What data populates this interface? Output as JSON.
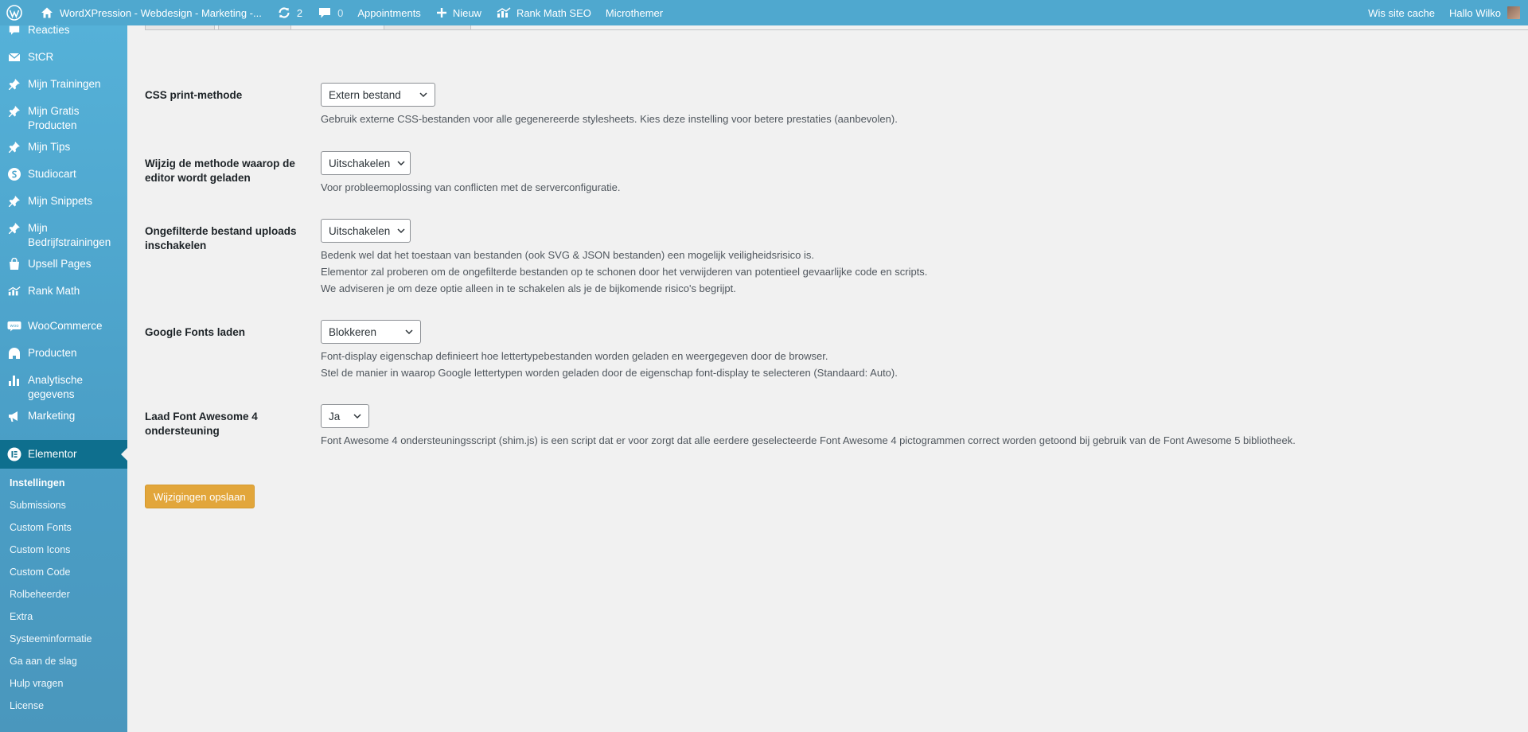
{
  "adminbar": {
    "site_title": "WordXPression - Webdesign - Marketing -...",
    "updates_count": "2",
    "comments_count": "0",
    "appointments": "Appointments",
    "new": "Nieuw",
    "rank_math": "Rank Math SEO",
    "microthemer": "Microthemer",
    "clear_cache": "Wis site cache",
    "greeting": "Hallo Wilko"
  },
  "sidebar": {
    "items": [
      {
        "label": "Reacties",
        "icon": "comment-icon"
      },
      {
        "label": "StCR",
        "icon": "mail-icon"
      },
      {
        "label": "Mijn Trainingen",
        "icon": "pin-icon"
      },
      {
        "label": "Mijn Gratis Producten",
        "icon": "pin-icon"
      },
      {
        "label": "Mijn Tips",
        "icon": "pin-icon"
      },
      {
        "label": "Studiocart",
        "icon": "studiocart-icon"
      },
      {
        "label": "Mijn Snippets",
        "icon": "pin-icon"
      },
      {
        "label": "Mijn Bedrijfstrainingen",
        "icon": "pin-icon"
      },
      {
        "label": "Upsell Pages",
        "icon": "bag-icon"
      },
      {
        "label": "Rank Math",
        "icon": "rank-math-icon"
      },
      {
        "label": "WooCommerce",
        "icon": "woocommerce-icon"
      },
      {
        "label": "Producten",
        "icon": "archive-icon"
      },
      {
        "label": "Analytische gegevens",
        "icon": "bar-chart-icon"
      },
      {
        "label": "Marketing",
        "icon": "megaphone-icon"
      },
      {
        "label": "Elementor",
        "icon": "elementor-icon"
      }
    ],
    "submenu": [
      "Instellingen",
      "Submissions",
      "Custom Fonts",
      "Custom Icons",
      "Custom Code",
      "Rolbeheerder",
      "Extra",
      "Systeeminformatie",
      "Ga aan de slag",
      "Hulp vragen",
      "License"
    ]
  },
  "settings": {
    "css_print": {
      "label": "CSS print-methode",
      "value": "Extern bestand",
      "desc": [
        "Gebruik externe CSS-bestanden voor alle gegenereerde stylesheets. Kies deze instelling voor betere prestaties (aanbevolen)."
      ]
    },
    "editor_load": {
      "label": "Wijzig de methode waarop de editor wordt geladen",
      "value": "Uitschakelen",
      "desc": [
        "Voor probleemoplossing van conflicten met de serverconfiguratie."
      ]
    },
    "unfiltered_uploads": {
      "label": "Ongefilterde bestand uploads inschakelen",
      "value": "Uitschakelen",
      "desc": [
        "Bedenk wel dat het toestaan van bestanden (ook SVG & JSON bestanden) een mogelijk veiligheidsrisico is.",
        "Elementor zal proberen om de ongefilterde bestanden op te schonen door het verwijderen van potentieel gevaarlijke code en scripts.",
        "We adviseren je om deze optie alleen in te schakelen als je de bijkomende risico's begrijpt."
      ]
    },
    "google_fonts": {
      "label": "Google Fonts laden",
      "value": "Blokkeren",
      "desc": [
        "Font-display eigenschap definieert hoe lettertypebestanden worden geladen en weergegeven door de browser.",
        "Stel de manier in waarop Google lettertypen worden geladen door de eigenschap font-display te selecteren (Standaard: Auto)."
      ]
    },
    "font_awesome": {
      "label": "Laad Font Awesome 4 ondersteuning",
      "value": "Ja",
      "desc": [
        "Font Awesome 4 ondersteuningsscript (shim.js) is een script dat er voor zorgt dat alle eerdere geselecteerde Font Awesome 4 pictogrammen correct worden getoond bij gebruik van de Font Awesome 5 bibliotheek."
      ]
    }
  },
  "save_button": "Wijzigingen opslaan",
  "colors": {
    "admin_bar": "#4fa8cf",
    "sidebar_active": "#0e6f8e",
    "save_button": "#e2a63b"
  }
}
